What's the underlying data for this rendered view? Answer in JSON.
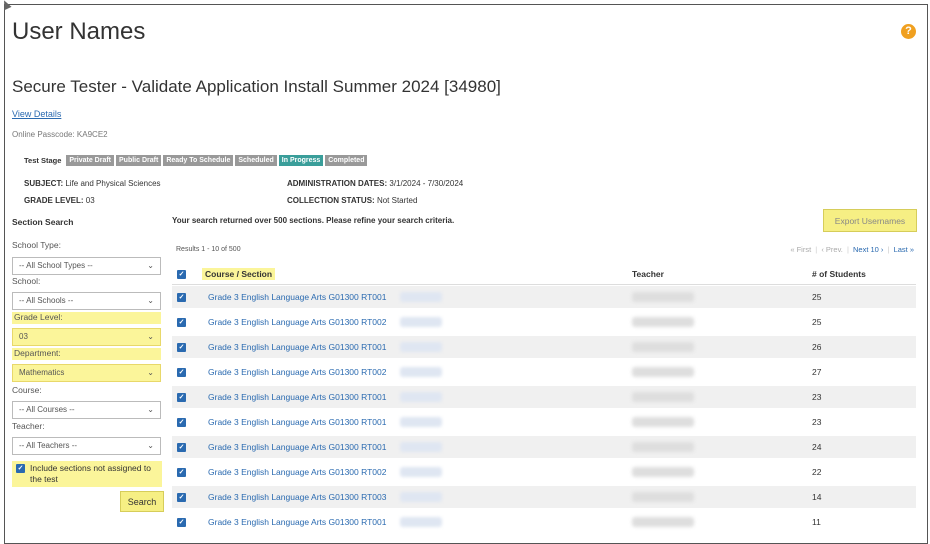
{
  "page": {
    "title": "User Names",
    "test_title": "Secure Tester - Validate Application Install Summer 2024 [34980]",
    "view_details": "View Details",
    "passcode": "Online Passcode: KA9CE2"
  },
  "stages": {
    "label": "Test Stage",
    "items": [
      {
        "label": "Private Draft",
        "active": false
      },
      {
        "label": "Public Draft",
        "active": false
      },
      {
        "label": "Ready To Schedule",
        "active": false
      },
      {
        "label": "Scheduled",
        "active": false
      },
      {
        "label": "In Progress",
        "active": true
      },
      {
        "label": "Completed",
        "active": false
      }
    ]
  },
  "meta": {
    "subject_label": "SUBJECT:",
    "subject_value": "Life and Physical Sciences",
    "grade_label": "GRADE LEVEL:",
    "grade_value": "03",
    "admin_label": "ADMINISTRATION DATES:",
    "admin_value": "3/1/2024 - 7/30/2024",
    "collection_label": "COLLECTION STATUS:",
    "collection_value": "Not Started"
  },
  "search": {
    "heading": "Section Search",
    "school_type_label": "School Type:",
    "school_type_value": "-- All School Types --",
    "school_label": "School:",
    "school_value": "-- All Schools --",
    "grade_label": "Grade Level:",
    "grade_value": "03",
    "department_label": "Department:",
    "department_value": "Mathematics",
    "course_label": "Course:",
    "course_value": "-- All Courses --",
    "teacher_label": "Teacher:",
    "teacher_value": "-- All Teachers --",
    "include_label": "Include sections not assigned to the test",
    "include_checked": true,
    "search_button": "Search"
  },
  "results": {
    "message": "Your search returned over 500 sections. Please refine your search criteria.",
    "export_button": "Export Usernames",
    "count": "Results 1 - 10 of 500",
    "pager": {
      "first": "« First",
      "prev": "‹ Prev.",
      "next": "Next 10 ›",
      "last": "Last »"
    },
    "columns": {
      "course": "Course / Section",
      "teacher": "Teacher",
      "students": "# of Students"
    },
    "rows": [
      {
        "course": "Grade 3 English Language Arts G01300 RT001",
        "students": "25"
      },
      {
        "course": "Grade 3 English Language Arts G01300 RT002",
        "students": "25"
      },
      {
        "course": "Grade 3 English Language Arts G01300 RT001",
        "students": "26"
      },
      {
        "course": "Grade 3 English Language Arts G01300 RT002",
        "students": "27"
      },
      {
        "course": "Grade 3 English Language Arts G01300 RT001",
        "students": "23"
      },
      {
        "course": "Grade 3 English Language Arts G01300 RT001",
        "students": "23"
      },
      {
        "course": "Grade 3 English Language Arts G01300 RT001",
        "students": "24"
      },
      {
        "course": "Grade 3 English Language Arts G01300 RT002",
        "students": "22"
      },
      {
        "course": "Grade 3 English Language Arts G01300 RT003",
        "students": "14"
      },
      {
        "course": "Grade 3 English Language Arts G01300 RT001",
        "students": "11"
      }
    ]
  },
  "icons": {
    "help": "help-icon",
    "checkbox": "checkbox-checked-icon",
    "chevron": "chevron-down-icon"
  },
  "colors": {
    "accent_link": "#2a6ab0",
    "highlight": "#fbf59a",
    "stage_active": "#3a9e9a",
    "stage_default": "#999999",
    "help": "#f0a020"
  }
}
